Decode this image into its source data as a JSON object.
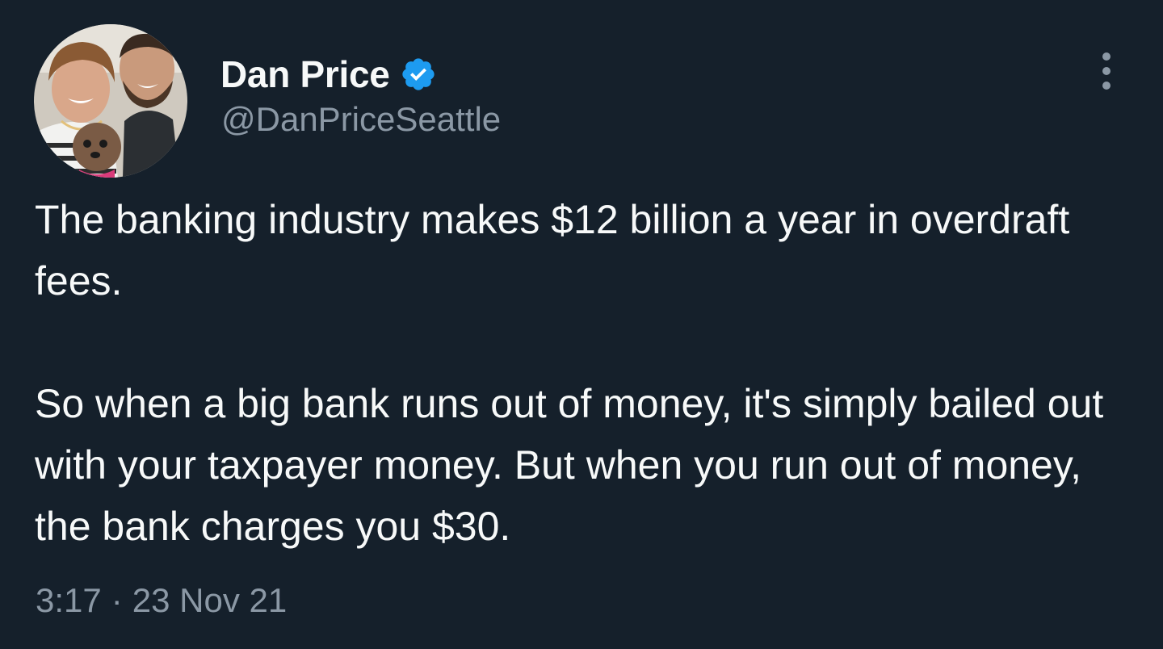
{
  "author": {
    "display_name": "Dan Price",
    "handle": "@DanPriceSeattle",
    "verified": true,
    "verified_icon": "verified-badge-icon",
    "avatar_icon": "profile-photo"
  },
  "tweet": {
    "paragraphs": [
      "The banking industry makes $12 billion a year in overdraft fees.",
      "So when a big bank runs out of money, it's simply bailed out with your taxpayer money. But when you run out of money, the bank charges you $30."
    ],
    "time": "3:17",
    "separator": "·",
    "date": "23 Nov 21"
  },
  "actions": {
    "more_icon": "more-options-icon"
  },
  "colors": {
    "background": "#15202b",
    "text_primary": "#f7f9f9",
    "text_secondary": "#8b98a5",
    "verified_blue": "#1d9bf0"
  }
}
